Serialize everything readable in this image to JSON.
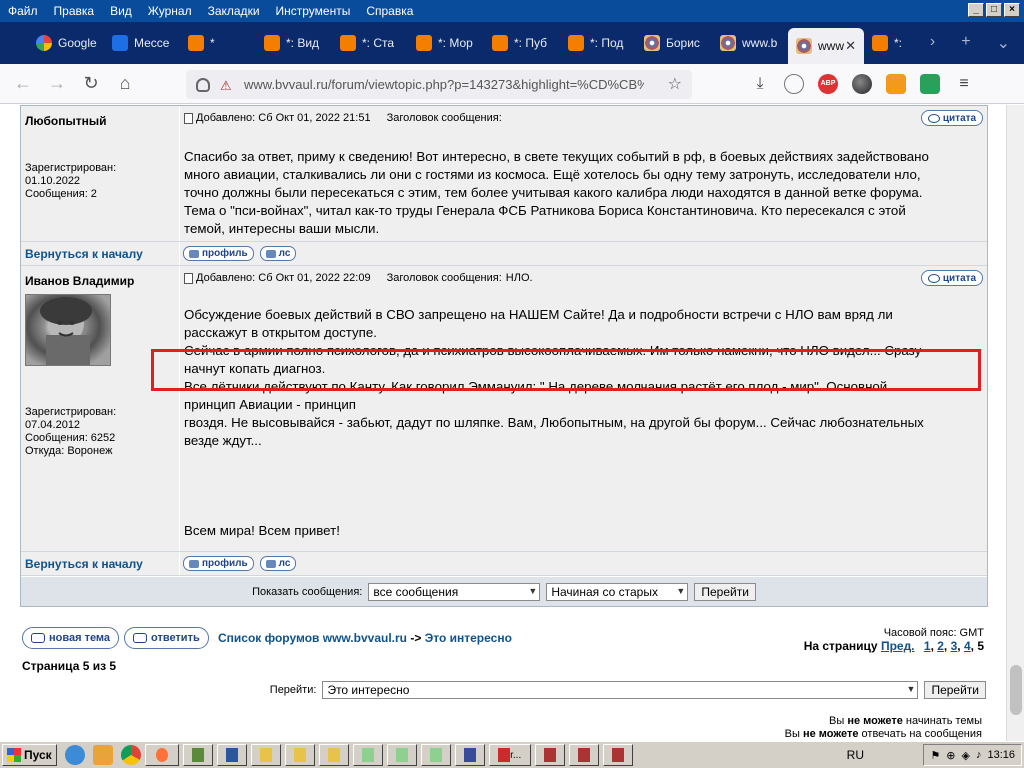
{
  "menubar": {
    "items": [
      "Файл",
      "Правка",
      "Вид",
      "Журнал",
      "Закладки",
      "Инструменты",
      "Справка"
    ]
  },
  "tabs": [
    {
      "label": "Google",
      "icon": "google-icon"
    },
    {
      "label": "Мессе",
      "icon": "messenger-icon"
    },
    {
      "label": "*",
      "icon": "blogger-icon"
    },
    {
      "label": "*: Вид",
      "icon": "blogger-icon"
    },
    {
      "label": "*: Ста",
      "icon": "blogger-icon"
    },
    {
      "label": "*: Мор",
      "icon": "blogger-icon"
    },
    {
      "label": "*: Пуб",
      "icon": "blogger-icon"
    },
    {
      "label": "*: Под",
      "icon": "blogger-icon"
    },
    {
      "label": "Борис",
      "icon": "star-icon"
    },
    {
      "label": "www.b",
      "icon": "star-icon"
    },
    {
      "label": "www",
      "icon": "star-icon",
      "active": true
    },
    {
      "label": "*:",
      "icon": "blogger-icon"
    }
  ],
  "urlbar": {
    "host": "www.bvvaul.ru",
    "path": "/forum/viewtopic.php?p=143273&highlight=%CD%CB%CE"
  },
  "posts": [
    {
      "author": "Любопытный",
      "registered": "Зарегистрирован: 01.10.2022",
      "messages": "Сообщения: 2",
      "added": "Добавлено: Сб Окт 01, 2022 21:51",
      "subject_label": "Заголовок сообщения:",
      "subject": "",
      "quote_label": "цитата",
      "text": [
        "Спасибо за ответ, приму к сведению! Вот интересно, в свете текущих событий в рф, в боевых действиях задействовано",
        "много авиации, сталкивались ли они с гостями из космоса. Ещё хотелось бы одну тему затронуть, исследователи нло,",
        "точно должны были пересекаться с этим, тем более учитывая какого калибра люди находятся в данной ветке форума.",
        "Тема о \"пси-войнах\", читал как-то труды Генерала ФСБ Ратникова Бориса Константиновича. Кто пересекался с этой",
        "темой, интересны ваши мысли."
      ]
    },
    {
      "author": "Иванов Владимир",
      "registered": "Зарегистрирован: 07.04.2012",
      "messages": "Сообщения: 6252",
      "location": "Откуда: Воронеж",
      "added": "Добавлено: Сб Окт 01, 2022 22:09",
      "subject_label": "Заголовок сообщения:",
      "subject": "НЛО.",
      "quote_label": "цитата",
      "text": [
        "Обсуждение боевых действий в СВО запрещено на НАШЕМ Сайте! Да и подробности встречи с НЛО вам вряд ли",
        "расскажут в открытом доступе.",
        "Сейчас в армии полно психологов, да и психиатров высокооплачиваемых. Им только намекни, что НЛО видел... Сразу",
        "начнут копать диагноз.",
        "Все лётчики действуют по Канту. Как говорил Эммануил: \" На дереве молчания растёт его плод - мир\". Основной",
        "принцип Авиации - принцип",
        "гвоздя. Не высовывайся - забьют, дадут по шляпке. Вам, Любопытным, на другой бы форум... Сейчас любознательных",
        "везде ждут..."
      ],
      "closing": "Всем мира! Всем привет!"
    }
  ],
  "post_buttons": {
    "back": "Вернуться к началу",
    "profile": "профиль",
    "pm": "лс"
  },
  "filter": {
    "label": "Показать сообщения:",
    "show_value": "все сообщения",
    "order_value": "Начиная со старых",
    "go": "Перейти"
  },
  "below": {
    "new_topic": "новая тема",
    "reply": "ответить",
    "crumb_forum": "Список форумов www.bvvaul.ru",
    "crumb_arrow": "->",
    "crumb_topic": "Это интересно",
    "timezone": "Часовой пояс: GMT",
    "pages_label": "На страницу",
    "prev": "Пред.",
    "page1": "1",
    "page2": "2",
    "page3": "3",
    "page4": "4",
    "page5": "5",
    "page_of": "Страница 5 из 5",
    "jump_label": "Перейти:",
    "jump_value": "Это интересно",
    "jump_go": "Перейти",
    "perm1_a": "Вы ",
    "perm1_b": "не можете",
    "perm1_c": " начинать темы",
    "perm2_a": "Вы ",
    "perm2_b": "не можете",
    "perm2_c": " отвечать на сообщения"
  },
  "taskbar": {
    "start": "Пуск",
    "lang": "RU",
    "clock": "13:16",
    "task_label": "r..."
  },
  "colors": {
    "menubar": "#0a4c9c",
    "tabbar": "#0a2a6c",
    "link": "#105289",
    "highlight": "#e02020",
    "post_bg": "#efefef"
  }
}
